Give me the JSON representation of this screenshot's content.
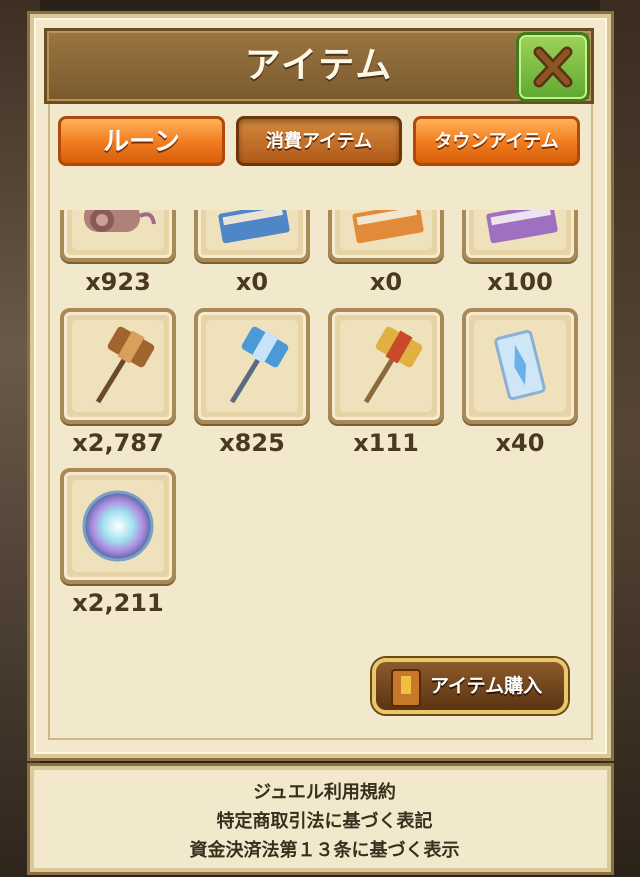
{
  "header": {
    "title": "アイテム"
  },
  "tabs": [
    {
      "label": "ルーン"
    },
    {
      "label": "消費アイテム"
    },
    {
      "label": "タウンアイテム"
    }
  ],
  "items": [
    {
      "icon": "scroll-icon",
      "count": "x923"
    },
    {
      "icon": "blue-book-icon",
      "count": "x0"
    },
    {
      "icon": "orange-book-icon",
      "count": "x0"
    },
    {
      "icon": "purple-book-icon",
      "count": "x100"
    },
    {
      "icon": "bronze-hammer-icon",
      "count": "x2,787"
    },
    {
      "icon": "blue-hammer-icon",
      "count": "x825"
    },
    {
      "icon": "gold-hammer-icon",
      "count": "x111"
    },
    {
      "icon": "crystal-ticket-icon",
      "count": "x40"
    },
    {
      "icon": "rainbow-orb-icon",
      "count": "x2,211"
    }
  ],
  "buy_button": {
    "label": "アイテム購入",
    "icon": "book-icon"
  },
  "footer": {
    "links": [
      "ジュエル利用規約",
      "特定商取引法に基づく表記",
      "資金決済法第１３条に基づく表示"
    ]
  },
  "colors": {
    "panel": "#f2e9cd",
    "title_bar": "#8a6634",
    "tab_orange": "#f07a1c",
    "close_green": "#6cb43a",
    "count_text": "#4a3820"
  }
}
